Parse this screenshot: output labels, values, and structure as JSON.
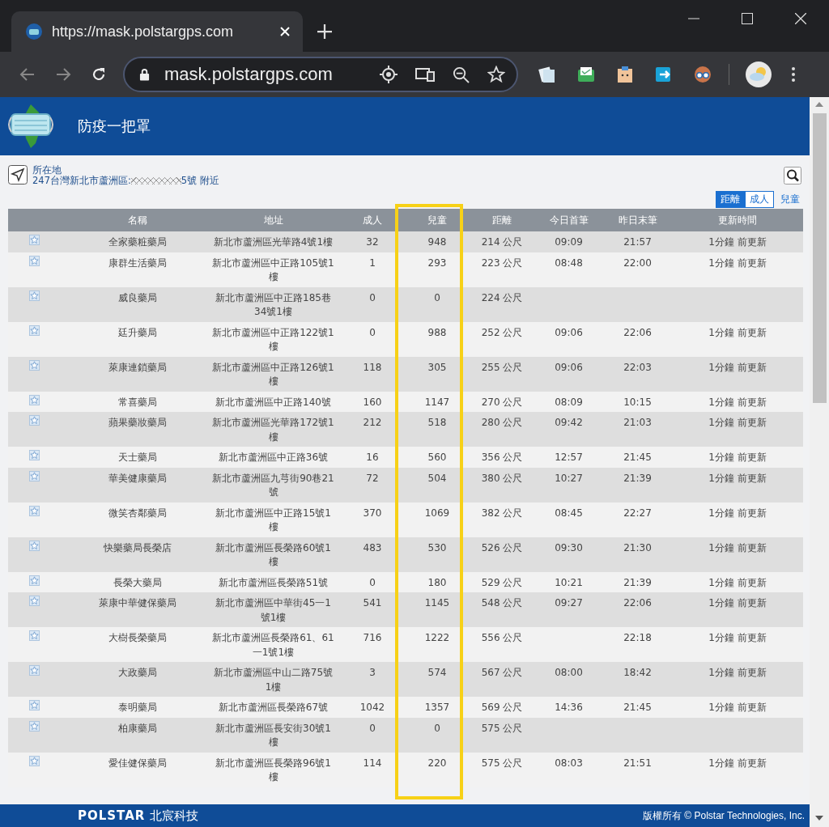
{
  "browser": {
    "tab": {
      "title": "https://mask.polstargps.com"
    },
    "address_bar": {
      "value": "mask.polstargps.com"
    }
  },
  "header": {
    "title": "防疫一把罩"
  },
  "location": {
    "label": "所在地",
    "address": "247台灣新北市蘆洲區:",
    "address_suffix": "5號 附近"
  },
  "sort_buttons": [
    {
      "label": "距離",
      "selected": true,
      "kind": "toggle"
    },
    {
      "label": "成人",
      "selected": false,
      "kind": "toggle"
    },
    {
      "label": "兒童",
      "selected": false,
      "kind": "link"
    }
  ],
  "table": {
    "columns": [
      "名稱",
      "地址",
      "成人",
      "兒童",
      "距離",
      "今日首筆",
      "昨日末筆",
      "更新時間"
    ],
    "rows": [
      {
        "name": "全家藥粧藥局",
        "address": "新北市蘆洲區光華路4號1樓",
        "adult": "32",
        "child": "948",
        "distance": "214 公尺",
        "first_today": "09:09",
        "last_yesterday": "21:57",
        "updated": "1分鐘 前更新"
      },
      {
        "name": "康群生活藥局",
        "address": "新北市蘆洲區中正路105號1樓",
        "adult": "1",
        "child": "293",
        "distance": "223 公尺",
        "first_today": "08:48",
        "last_yesterday": "22:00",
        "updated": "1分鐘 前更新"
      },
      {
        "name": "威良藥局",
        "address": "新北市蘆洲區中正路185巷34號1樓",
        "adult": "0",
        "child": "0",
        "distance": "224 公尺"
      },
      {
        "name": "廷升藥局",
        "address": "新北市蘆洲區中正路122號1樓",
        "adult": "0",
        "child": "988",
        "distance": "252 公尺",
        "first_today": "09:06",
        "last_yesterday": "22:06",
        "updated": "1分鐘 前更新"
      },
      {
        "name": "萊康連鎖藥局",
        "address": "新北市蘆洲區中正路126號1樓",
        "adult": "118",
        "child": "305",
        "distance": "255 公尺",
        "first_today": "09:06",
        "last_yesterday": "22:03",
        "updated": "1分鐘 前更新"
      },
      {
        "name": "常喜藥局",
        "address": "新北市蘆洲區中正路140號",
        "adult": "160",
        "child": "1147",
        "distance": "270 公尺",
        "first_today": "08:09",
        "last_yesterday": "10:15",
        "updated": "1分鐘 前更新"
      },
      {
        "name": "蘋果藥妝藥局",
        "address": "新北市蘆洲區光華路172號1樓",
        "adult": "212",
        "child": "518",
        "distance": "280 公尺",
        "first_today": "09:42",
        "last_yesterday": "21:03",
        "updated": "1分鐘 前更新"
      },
      {
        "name": "天士藥局",
        "address": "新北市蘆洲區中正路36號",
        "adult": "16",
        "child": "560",
        "distance": "356 公尺",
        "first_today": "12:57",
        "last_yesterday": "21:45",
        "updated": "1分鐘 前更新"
      },
      {
        "name": "華美健康藥局",
        "address": "新北市蘆洲區九芎街90巷21號",
        "adult": "72",
        "child": "504",
        "distance": "380 公尺",
        "first_today": "10:27",
        "last_yesterday": "21:39",
        "updated": "1分鐘 前更新"
      },
      {
        "name": "微笑杏鄰藥局",
        "address": "新北市蘆洲區中正路15號1樓",
        "adult": "370",
        "child": "1069",
        "distance": "382 公尺",
        "first_today": "08:45",
        "last_yesterday": "22:27",
        "updated": "1分鐘 前更新"
      },
      {
        "name": "快樂藥局長榮店",
        "address": "新北市蘆洲區長榮路60號1樓",
        "adult": "483",
        "child": "530",
        "distance": "526 公尺",
        "first_today": "09:30",
        "last_yesterday": "21:30",
        "updated": "1分鐘 前更新"
      },
      {
        "name": "長榮大藥局",
        "address": "新北市蘆洲區長榮路51號",
        "adult": "0",
        "child": "180",
        "distance": "529 公尺",
        "first_today": "10:21",
        "last_yesterday": "21:39",
        "updated": "1分鐘 前更新"
      },
      {
        "name": "萊康中華健保藥局",
        "address": "新北市蘆洲區中華街45一1號1樓",
        "adult": "541",
        "child": "1145",
        "distance": "548 公尺",
        "first_today": "09:27",
        "last_yesterday": "22:06",
        "updated": "1分鐘 前更新"
      },
      {
        "name": "大樹長榮藥局",
        "address": "新北市蘆洲區長榮路61、61一1號1樓",
        "adult": "716",
        "child": "1222",
        "distance": "556 公尺",
        "last_yesterday": "22:18",
        "updated": "1分鐘 前更新"
      },
      {
        "name": "大政藥局",
        "address": "新北市蘆洲區中山二路75號1樓",
        "adult": "3",
        "child": "574",
        "distance": "567 公尺",
        "first_today": "08:00",
        "last_yesterday": "18:42",
        "updated": "1分鐘 前更新"
      },
      {
        "name": "泰明藥局",
        "address": "新北市蘆洲區長榮路67號",
        "adult": "1042",
        "child": "1357",
        "distance": "569 公尺",
        "first_today": "14:36",
        "last_yesterday": "21:45",
        "updated": "1分鐘 前更新"
      },
      {
        "name": "柏康藥局",
        "address": "新北市蘆洲區長安街30號1樓",
        "adult": "0",
        "child": "0",
        "distance": "575 公尺"
      },
      {
        "name": "愛佳健保藥局",
        "address": "新北市蘆洲區長榮路96號1樓",
        "adult": "114",
        "child": "220",
        "distance": "575 公尺",
        "first_today": "08:03",
        "last_yesterday": "21:51",
        "updated": "1分鐘 前更新"
      }
    ]
  },
  "footer": {
    "brand": "POLSTAR",
    "brand_chinese": "北宸科技",
    "copyright": "版權所有 © Polstar Technologies, Inc."
  }
}
